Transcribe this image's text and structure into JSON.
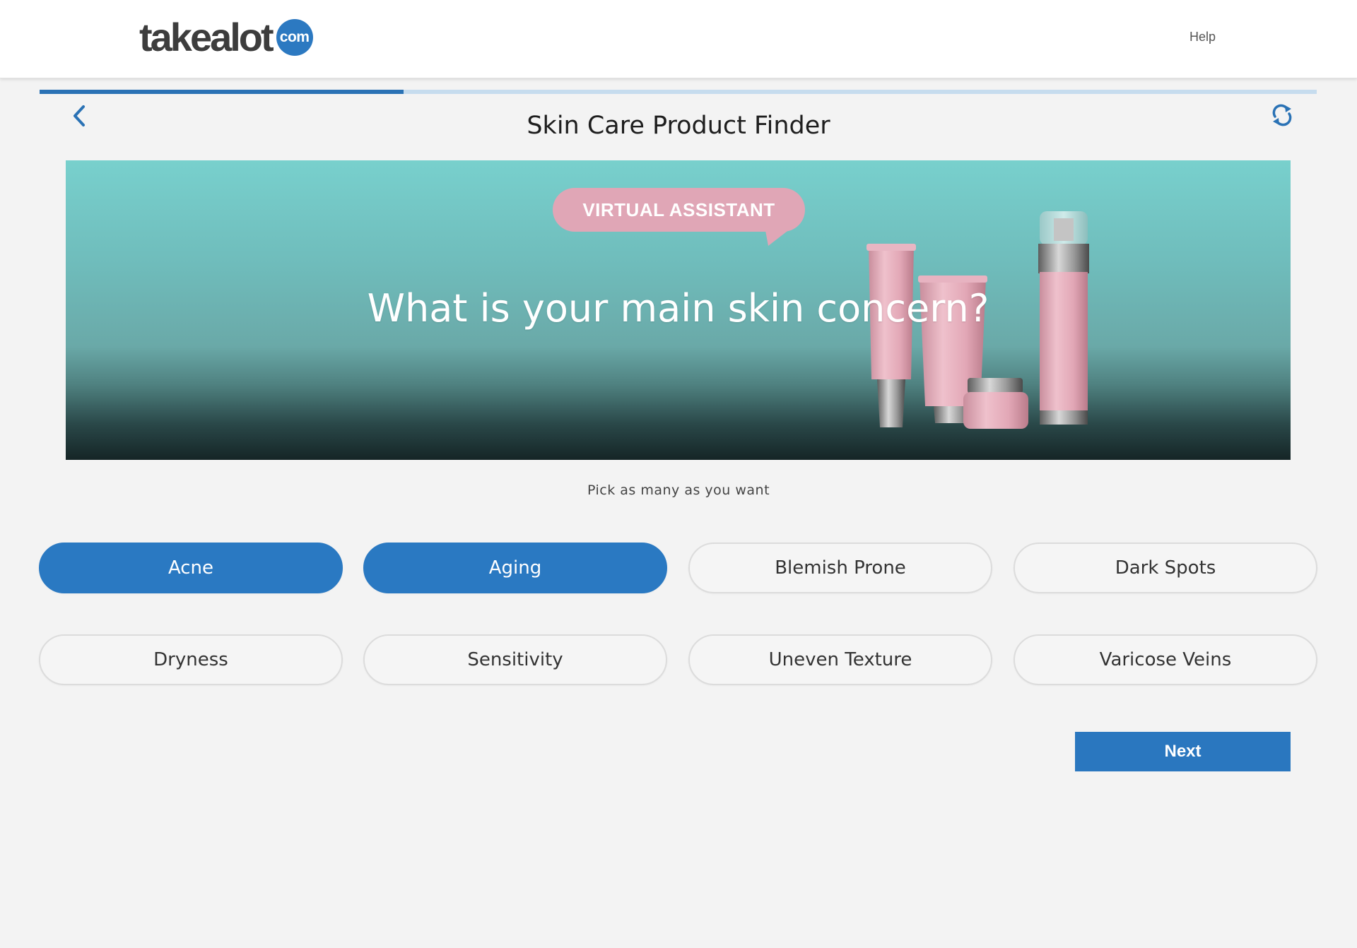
{
  "header": {
    "logo_text": "takealot",
    "logo_badge": "com",
    "help_label": "Help"
  },
  "progress": {
    "fraction": 0.285
  },
  "nav": {
    "back_icon": "chevron-left-icon",
    "restart_icon": "refresh-icon"
  },
  "page": {
    "title": "Skin Care Product Finder"
  },
  "banner": {
    "badge": "VIRTUAL ASSISTANT",
    "question": "What is your main skin concern?"
  },
  "hint": "Pick as many as you want",
  "options": [
    {
      "label": "Acne",
      "selected": true
    },
    {
      "label": "Aging",
      "selected": true
    },
    {
      "label": "Blemish Prone",
      "selected": false
    },
    {
      "label": "Dark Spots",
      "selected": false
    },
    {
      "label": "Dryness",
      "selected": false
    },
    {
      "label": "Sensitivity",
      "selected": false
    },
    {
      "label": "Uneven Texture",
      "selected": false
    },
    {
      "label": "Varicose Veins",
      "selected": false
    }
  ],
  "actions": {
    "next_label": "Next"
  },
  "colors": {
    "accent": "#2a79c2",
    "background": "#f3f3f3",
    "badge_pink": "#e0a6b6"
  }
}
